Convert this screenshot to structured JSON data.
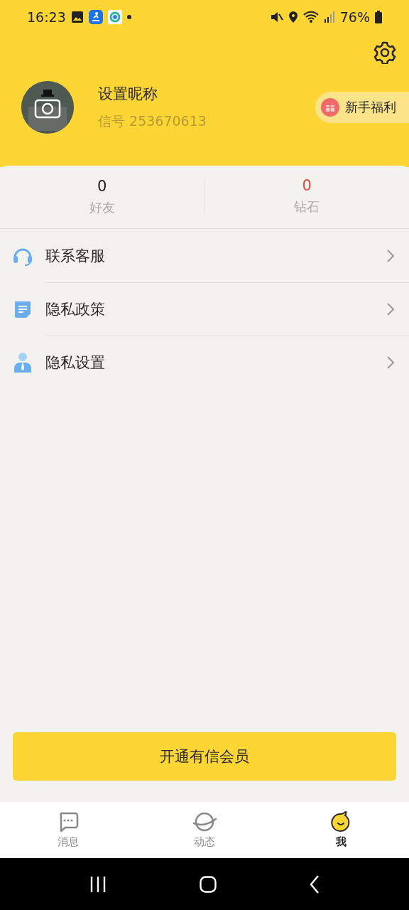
{
  "status_bar": {
    "time": "16:23",
    "battery": "76%"
  },
  "profile": {
    "nickname": "设置昵称",
    "account": "信号 253670613",
    "welfare": "新手福利"
  },
  "stats": [
    {
      "value": "0",
      "label": "好友",
      "color": "#222222"
    },
    {
      "value": "0",
      "label": "钻石",
      "color": "#e0483e"
    }
  ],
  "menu": [
    {
      "kind": "headset",
      "label": "联系客服"
    },
    {
      "kind": "document",
      "label": "隐私政策"
    },
    {
      "kind": "person",
      "label": "隐私设置"
    }
  ],
  "vip_button": "开通有信会员",
  "tabs": [
    {
      "kind": "chat",
      "label": "消息",
      "selected": false
    },
    {
      "kind": "planet",
      "label": "动态",
      "selected": false
    },
    {
      "kind": "mascot",
      "label": "我",
      "selected": true
    }
  ]
}
